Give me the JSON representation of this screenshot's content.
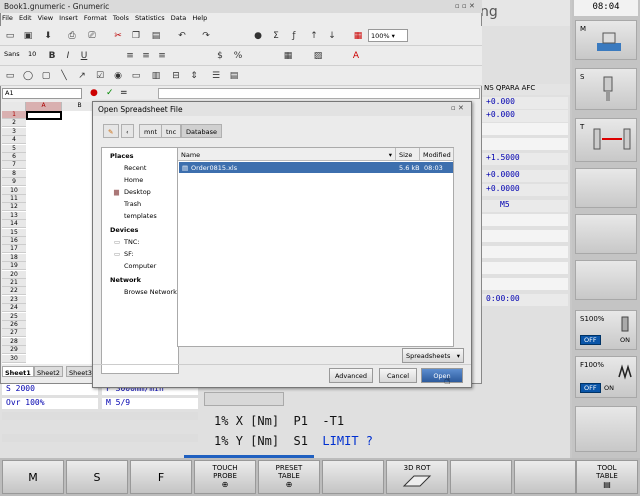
{
  "cnc": {
    "title_partial": "ng",
    "clock": "08:04",
    "columns": [
      "NS",
      "QPARA",
      "AFC"
    ],
    "rows": [
      "+0.000",
      "+0.000",
      "",
      "",
      "+1.5000",
      "+0.0000",
      "+0.0000",
      "M5",
      "",
      "",
      "",
      "",
      "",
      "0:00:00"
    ],
    "status_left": [
      {
        "a": "S 2000",
        "b": "F 3000mm/min"
      },
      {
        "a": "Ovr 100%",
        "b": "M 5/9"
      }
    ],
    "readout": [
      {
        "pct": "1%",
        "axis": "X",
        "unit": "[Nm]",
        "p": "P1",
        "val": "-T1"
      },
      {
        "pct": "1%",
        "axis": "Y",
        "unit": "[Nm]",
        "p": "S1",
        "val": "LIMIT ?"
      }
    ],
    "right_keys": [
      {
        "label": ""
      },
      {
        "label": "M"
      },
      {
        "label": "S"
      },
      {
        "label": "T"
      },
      {
        "label": ""
      },
      {
        "label": ""
      },
      {
        "label": "S100%",
        "off": "OFF",
        "on": "ON"
      },
      {
        "label": "F100%",
        "off": "OFF",
        "on": "ON"
      },
      {
        "label": ""
      }
    ],
    "bottom_keys": [
      {
        "big": "M"
      },
      {
        "big": "S"
      },
      {
        "big": "F"
      },
      {
        "l1": "TOUCH",
        "l2": "PROBE"
      },
      {
        "l1": "PRESET",
        "l2": "TABLE"
      },
      {
        "l1": ""
      },
      {
        "l1": "3D ROT"
      },
      {
        "l1": ""
      },
      {
        "l1": "",
        "l2": ""
      },
      {
        "l1": "TOOL",
        "l2": "TABLE"
      }
    ]
  },
  "gnumeric": {
    "title": "Book1.gnumeric - Gnumeric",
    "menu": [
      "File",
      "Edit",
      "View",
      "Insert",
      "Format",
      "Tools",
      "Statistics",
      "Data",
      "Help"
    ],
    "zoom": "100%",
    "font_name": "Sans",
    "font_size": "10",
    "cell_ref": "A1",
    "columns": [
      "A",
      "B"
    ],
    "rows": [
      "1",
      "2",
      "3",
      "4",
      "5",
      "6",
      "7",
      "8",
      "9",
      "10",
      "11",
      "12",
      "13",
      "14",
      "15",
      "16",
      "17",
      "18",
      "19",
      "20",
      "21",
      "22",
      "23",
      "24",
      "25",
      "26",
      "27",
      "28",
      "29",
      "30"
    ],
    "sheets": [
      "Sheet1",
      "Sheet2",
      "Sheet3"
    ]
  },
  "dialog": {
    "title": "Open Spreadsheet File",
    "path": [
      "mnt",
      "tnc",
      "Database"
    ],
    "places_header": "Places",
    "places": [
      "Recent",
      "Home",
      "Desktop",
      "Trash",
      "templates"
    ],
    "devices_header": "Devices",
    "devices": [
      "TNC:",
      "SF:",
      "Computer"
    ],
    "network_header": "Network",
    "network": [
      "Browse Network"
    ],
    "col_name": "Name",
    "col_size": "Size",
    "col_modified": "Modified",
    "file_name": "Order0815.xls",
    "file_size": "5.6 kB",
    "file_modified": "08:03",
    "filter": "Spreadsheets",
    "btn_advanced": "Advanced",
    "btn_cancel": "Cancel",
    "btn_open": "Open"
  }
}
